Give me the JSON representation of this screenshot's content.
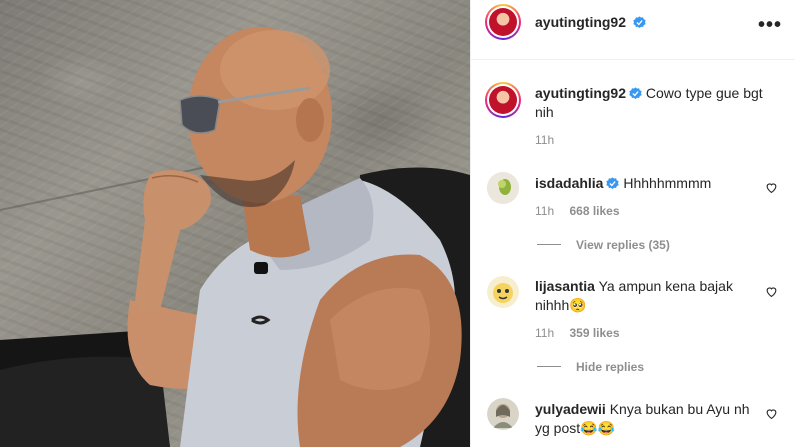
{
  "header": {
    "username": "ayutingting92",
    "more_label": "•••"
  },
  "caption": {
    "username": "ayutingting92",
    "text": "Cowo type gue bgt nih",
    "time": "11h"
  },
  "comments": [
    {
      "username": "isdadahlia",
      "verified": true,
      "text": "Hhhhhmmmm",
      "time": "11h",
      "likes": "668 likes",
      "replies_label": "View replies (35)"
    },
    {
      "username": "lijasantia",
      "verified": false,
      "text": "Ya ampun kena bajak nihhh🥺",
      "time": "11h",
      "likes": "359 likes",
      "replies_label": "Hide replies"
    },
    {
      "username": "yulyadewii",
      "verified": false,
      "text": "Knya bukan bu Ayu nh yg post😂😂"
    }
  ],
  "colors": {
    "verified_blue": "#3897f0",
    "muted": "#8e8e8e",
    "text": "#262626",
    "divider": "#efefef"
  }
}
